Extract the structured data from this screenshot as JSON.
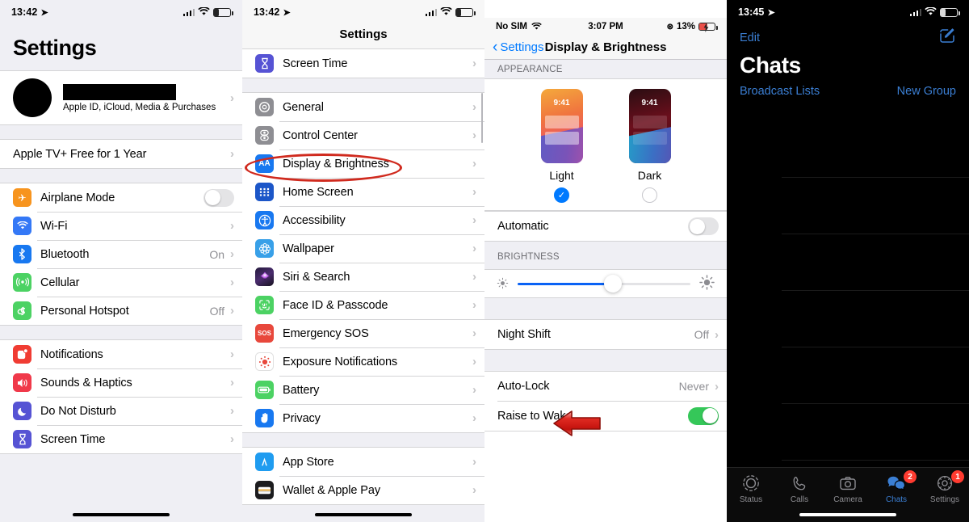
{
  "panel1": {
    "statusbar": {
      "time": "13:42",
      "location_icon": "location-arrow-icon",
      "wifi_icon": "wifi-icon",
      "battery_icon": "battery-icon"
    },
    "title": "Settings",
    "account": {
      "name_redacted": "",
      "subtitle": "Apple ID, iCloud, Media & Purchases"
    },
    "promo": {
      "label": "Apple TV+ Free for 1 Year"
    },
    "group_connectivity": [
      {
        "label": "Airplane Mode",
        "icon": "airplane-icon",
        "control": "toggle",
        "toggle_on": false
      },
      {
        "label": "Wi-Fi",
        "icon": "wifi-icon",
        "control": "chevron",
        "value": ""
      },
      {
        "label": "Bluetooth",
        "icon": "bluetooth-icon",
        "control": "chevron",
        "value": "On"
      },
      {
        "label": "Cellular",
        "icon": "cellular-icon",
        "control": "chevron",
        "value": ""
      },
      {
        "label": "Personal Hotspot",
        "icon": "hotspot-icon",
        "control": "chevron",
        "value": "Off"
      }
    ],
    "group_alerts": [
      {
        "label": "Notifications",
        "icon": "notifications-icon",
        "control": "chevron",
        "value": ""
      },
      {
        "label": "Sounds & Haptics",
        "icon": "sounds-icon",
        "control": "chevron",
        "value": ""
      },
      {
        "label": "Do Not Disturb",
        "icon": "moon-icon",
        "control": "chevron",
        "value": ""
      },
      {
        "label": "Screen Time",
        "icon": "hourglass-icon",
        "control": "chevron",
        "value": ""
      }
    ]
  },
  "panel2": {
    "statusbar": {
      "time": "13:42"
    },
    "nav_title": "Settings",
    "partial_top": {
      "label": "Screen Time",
      "icon": "hourglass-icon"
    },
    "group_system": [
      {
        "label": "General",
        "icon": "gear-icon"
      },
      {
        "label": "Control Center",
        "icon": "control-center-icon"
      },
      {
        "label": "Display & Brightness",
        "icon": "display-brightness-icon"
      },
      {
        "label": "Home Screen",
        "icon": "home-screen-icon"
      },
      {
        "label": "Accessibility",
        "icon": "accessibility-icon"
      },
      {
        "label": "Wallpaper",
        "icon": "wallpaper-icon"
      },
      {
        "label": "Siri & Search",
        "icon": "siri-icon"
      },
      {
        "label": "Face ID & Passcode",
        "icon": "face-id-icon"
      },
      {
        "label": "Emergency SOS",
        "icon": "sos-icon"
      },
      {
        "label": "Exposure Notifications",
        "icon": "exposure-notifications-icon"
      },
      {
        "label": "Battery",
        "icon": "battery-icon"
      },
      {
        "label": "Privacy",
        "icon": "privacy-hand-icon"
      }
    ],
    "group_store": [
      {
        "label": "App Store",
        "icon": "app-store-icon"
      },
      {
        "label": "Wallet & Apple Pay",
        "icon": "wallet-icon"
      }
    ],
    "annotation": {
      "type": "ellipse",
      "target": "Display & Brightness",
      "color": "#d02a1e"
    }
  },
  "panel3": {
    "statusbar": {
      "carrier": "No SIM",
      "time": "3:07 PM",
      "battery_percent": "13%",
      "charging": true,
      "lock_icon": "rotation-lock-icon"
    },
    "back_label": "Settings",
    "nav_title": "Display & Brightness",
    "section_appearance": "APPEARANCE",
    "themes": [
      {
        "name": "Light",
        "preview_time": "9:41",
        "selected": true
      },
      {
        "name": "Dark",
        "preview_time": "9:41",
        "selected": false
      }
    ],
    "automatic": {
      "label": "Automatic",
      "toggle_on": false
    },
    "section_brightness": "BRIGHTNESS",
    "brightness": {
      "value_percent": 55,
      "low_icon": "sun-small-icon",
      "high_icon": "sun-large-icon"
    },
    "rows": [
      {
        "label": "Night Shift",
        "value": "Off"
      },
      {
        "label": "Auto-Lock",
        "value": "Never"
      }
    ],
    "raise_to_wake": {
      "label": "Raise to Wake",
      "toggle_on": true
    },
    "annotation": {
      "type": "arrow-left",
      "target": "Auto-Lock",
      "color": "#d81f1f"
    }
  },
  "panel4": {
    "statusbar": {
      "time": "13:45"
    },
    "edit_label": "Edit",
    "compose_icon": "compose-icon",
    "title": "Chats",
    "broadcast_label": "Broadcast Lists",
    "new_group_label": "New Group",
    "chat_rows_count": 6,
    "tabs": [
      {
        "label": "Status",
        "icon": "status-rings-icon",
        "active": false,
        "badge": ""
      },
      {
        "label": "Calls",
        "icon": "phone-icon",
        "active": false,
        "badge": ""
      },
      {
        "label": "Camera",
        "icon": "camera-icon",
        "active": false,
        "badge": ""
      },
      {
        "label": "Chats",
        "icon": "chat-bubbles-icon",
        "active": true,
        "badge": "2"
      },
      {
        "label": "Settings",
        "icon": "gear-icon",
        "active": false,
        "badge": "1"
      }
    ]
  },
  "colors": {
    "ios_blue": "#007aff",
    "annotation_red": "#d02a1e",
    "toggle_green": "#35c759",
    "badge_red": "#ff3b30"
  }
}
